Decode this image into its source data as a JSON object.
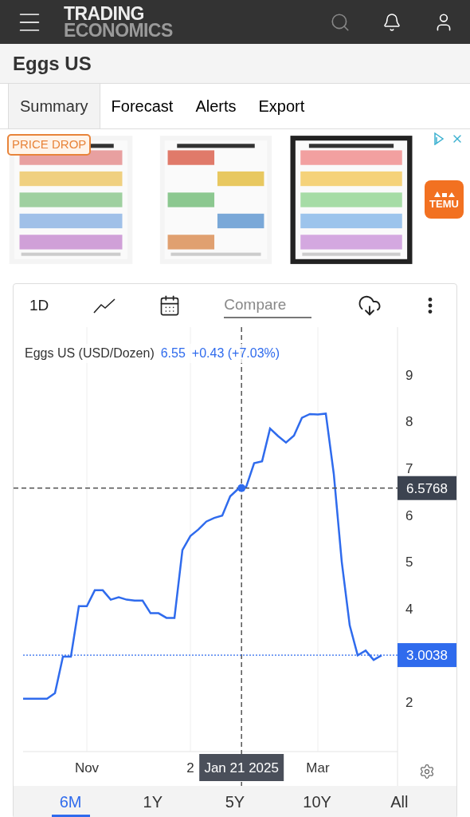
{
  "header": {
    "logo_top": "TRADING",
    "logo_bottom": "ECONOMICS"
  },
  "page_title": "Eggs US",
  "tabs": [
    {
      "label": "Summary",
      "selected": true
    },
    {
      "label": "Forecast",
      "selected": false
    },
    {
      "label": "Alerts",
      "selected": false
    },
    {
      "label": "Export",
      "selected": false
    }
  ],
  "ad": {
    "badge": "PRICE DROP",
    "brand": "TEMU"
  },
  "chart_toolbar": {
    "interval": "1D",
    "compare_placeholder": "Compare"
  },
  "legend": {
    "value": "6.55",
    "change": "+0.43 (+7.03%)"
  },
  "chart_data": {
    "type": "line",
    "categories": [
      null,
      null,
      null,
      null,
      null,
      null,
      null,
      null,
      "Nov",
      null,
      null,
      null,
      null,
      null,
      null,
      null,
      null,
      null,
      null,
      null,
      null,
      "2",
      null,
      null,
      null,
      null,
      null,
      null,
      null,
      null,
      null,
      null,
      null,
      null,
      null,
      null,
      null,
      "Mar",
      null,
      null,
      null,
      null,
      null,
      null,
      null,
      null
    ],
    "series": [
      {
        "name": "Eggs US (USD/Dozen)",
        "color": "#2f6bed",
        "values": [
          2.07,
          2.07,
          2.07,
          2.07,
          2.19,
          2.97,
          2.97,
          4.05,
          4.05,
          4.39,
          4.39,
          4.19,
          4.24,
          4.19,
          4.17,
          4.17,
          3.9,
          3.9,
          3.8,
          3.8,
          5.25,
          5.55,
          5.69,
          5.86,
          5.94,
          5.99,
          6.4,
          6.56,
          6.6,
          7.11,
          7.15,
          7.85,
          7.69,
          7.55,
          7.7,
          8.08,
          8.16,
          8.15,
          8.17,
          6.88,
          5.0,
          3.64,
          3.0,
          3.1,
          2.9,
          3.0
        ]
      }
    ],
    "ylim": [
      0.94,
      10.02
    ],
    "yticks": [
      2,
      4,
      5,
      6,
      7,
      8,
      9
    ],
    "grid": true,
    "ref_lines": [
      {
        "axis": "y",
        "value": 6.5768,
        "label": "6.5768"
      },
      {
        "axis": "y",
        "value": 3.0038,
        "label": "3.0038"
      }
    ],
    "annotations": [
      {
        "text": "Jan 21 2025"
      }
    ]
  },
  "ranges": [
    {
      "label": "6M",
      "selected": true
    },
    {
      "label": "1Y",
      "selected": false
    },
    {
      "label": "5Y",
      "selected": false
    },
    {
      "label": "10Y",
      "selected": false
    },
    {
      "label": "All",
      "selected": false
    }
  ]
}
